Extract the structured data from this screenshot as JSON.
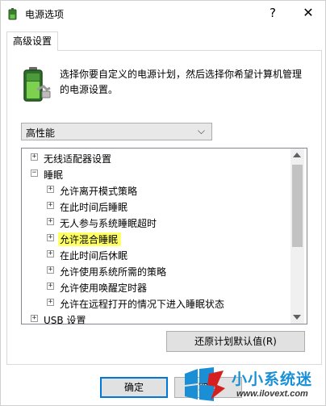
{
  "window": {
    "title": "电源选项",
    "help_glyph": "?",
    "close_glyph": "✕"
  },
  "tabs": [
    {
      "label": "高级设置",
      "active": true
    }
  ],
  "description": {
    "text": "选择你要自定义的电源计划，然后选择你希望计算机管理的电源设置。",
    "icon": "battery-power-icon"
  },
  "plan": {
    "selected": "高性能",
    "chevron": "⌵"
  },
  "tree": {
    "items": [
      {
        "label": "无线适配器设置",
        "expander": "+",
        "level": 0
      },
      {
        "label": "睡眠",
        "expander": "−",
        "level": 0
      },
      {
        "label": "允许离开模式策略",
        "expander": "+",
        "level": 1
      },
      {
        "label": "在此时间后睡眠",
        "expander": "+",
        "level": 1
      },
      {
        "label": "无人参与系统睡眠超时",
        "expander": "+",
        "level": 1
      },
      {
        "label": "允许混合睡眠",
        "expander": "+",
        "level": 1,
        "highlighted": true
      },
      {
        "label": "在此时间后休眠",
        "expander": "+",
        "level": 1
      },
      {
        "label": "允许使用系统所需的策略",
        "expander": "+",
        "level": 1
      },
      {
        "label": "允许使用唤醒定时器",
        "expander": "+",
        "level": 1
      },
      {
        "label": "允许在远程打开的情况下进入睡眠状态",
        "expander": "+",
        "level": 1
      },
      {
        "label": "USB 设置",
        "expander": "+",
        "level": 0
      }
    ],
    "highlight_color": "#ffff66"
  },
  "buttons": {
    "restore": "还原计划默认值(R)",
    "ok": "确定",
    "cancel": "取消"
  },
  "watermark": {
    "name": "小小系统迷",
    "url": "www.ilovext.com"
  },
  "colors": {
    "accent": "#0078d7",
    "watermark_blue": "#1a8fd6"
  }
}
